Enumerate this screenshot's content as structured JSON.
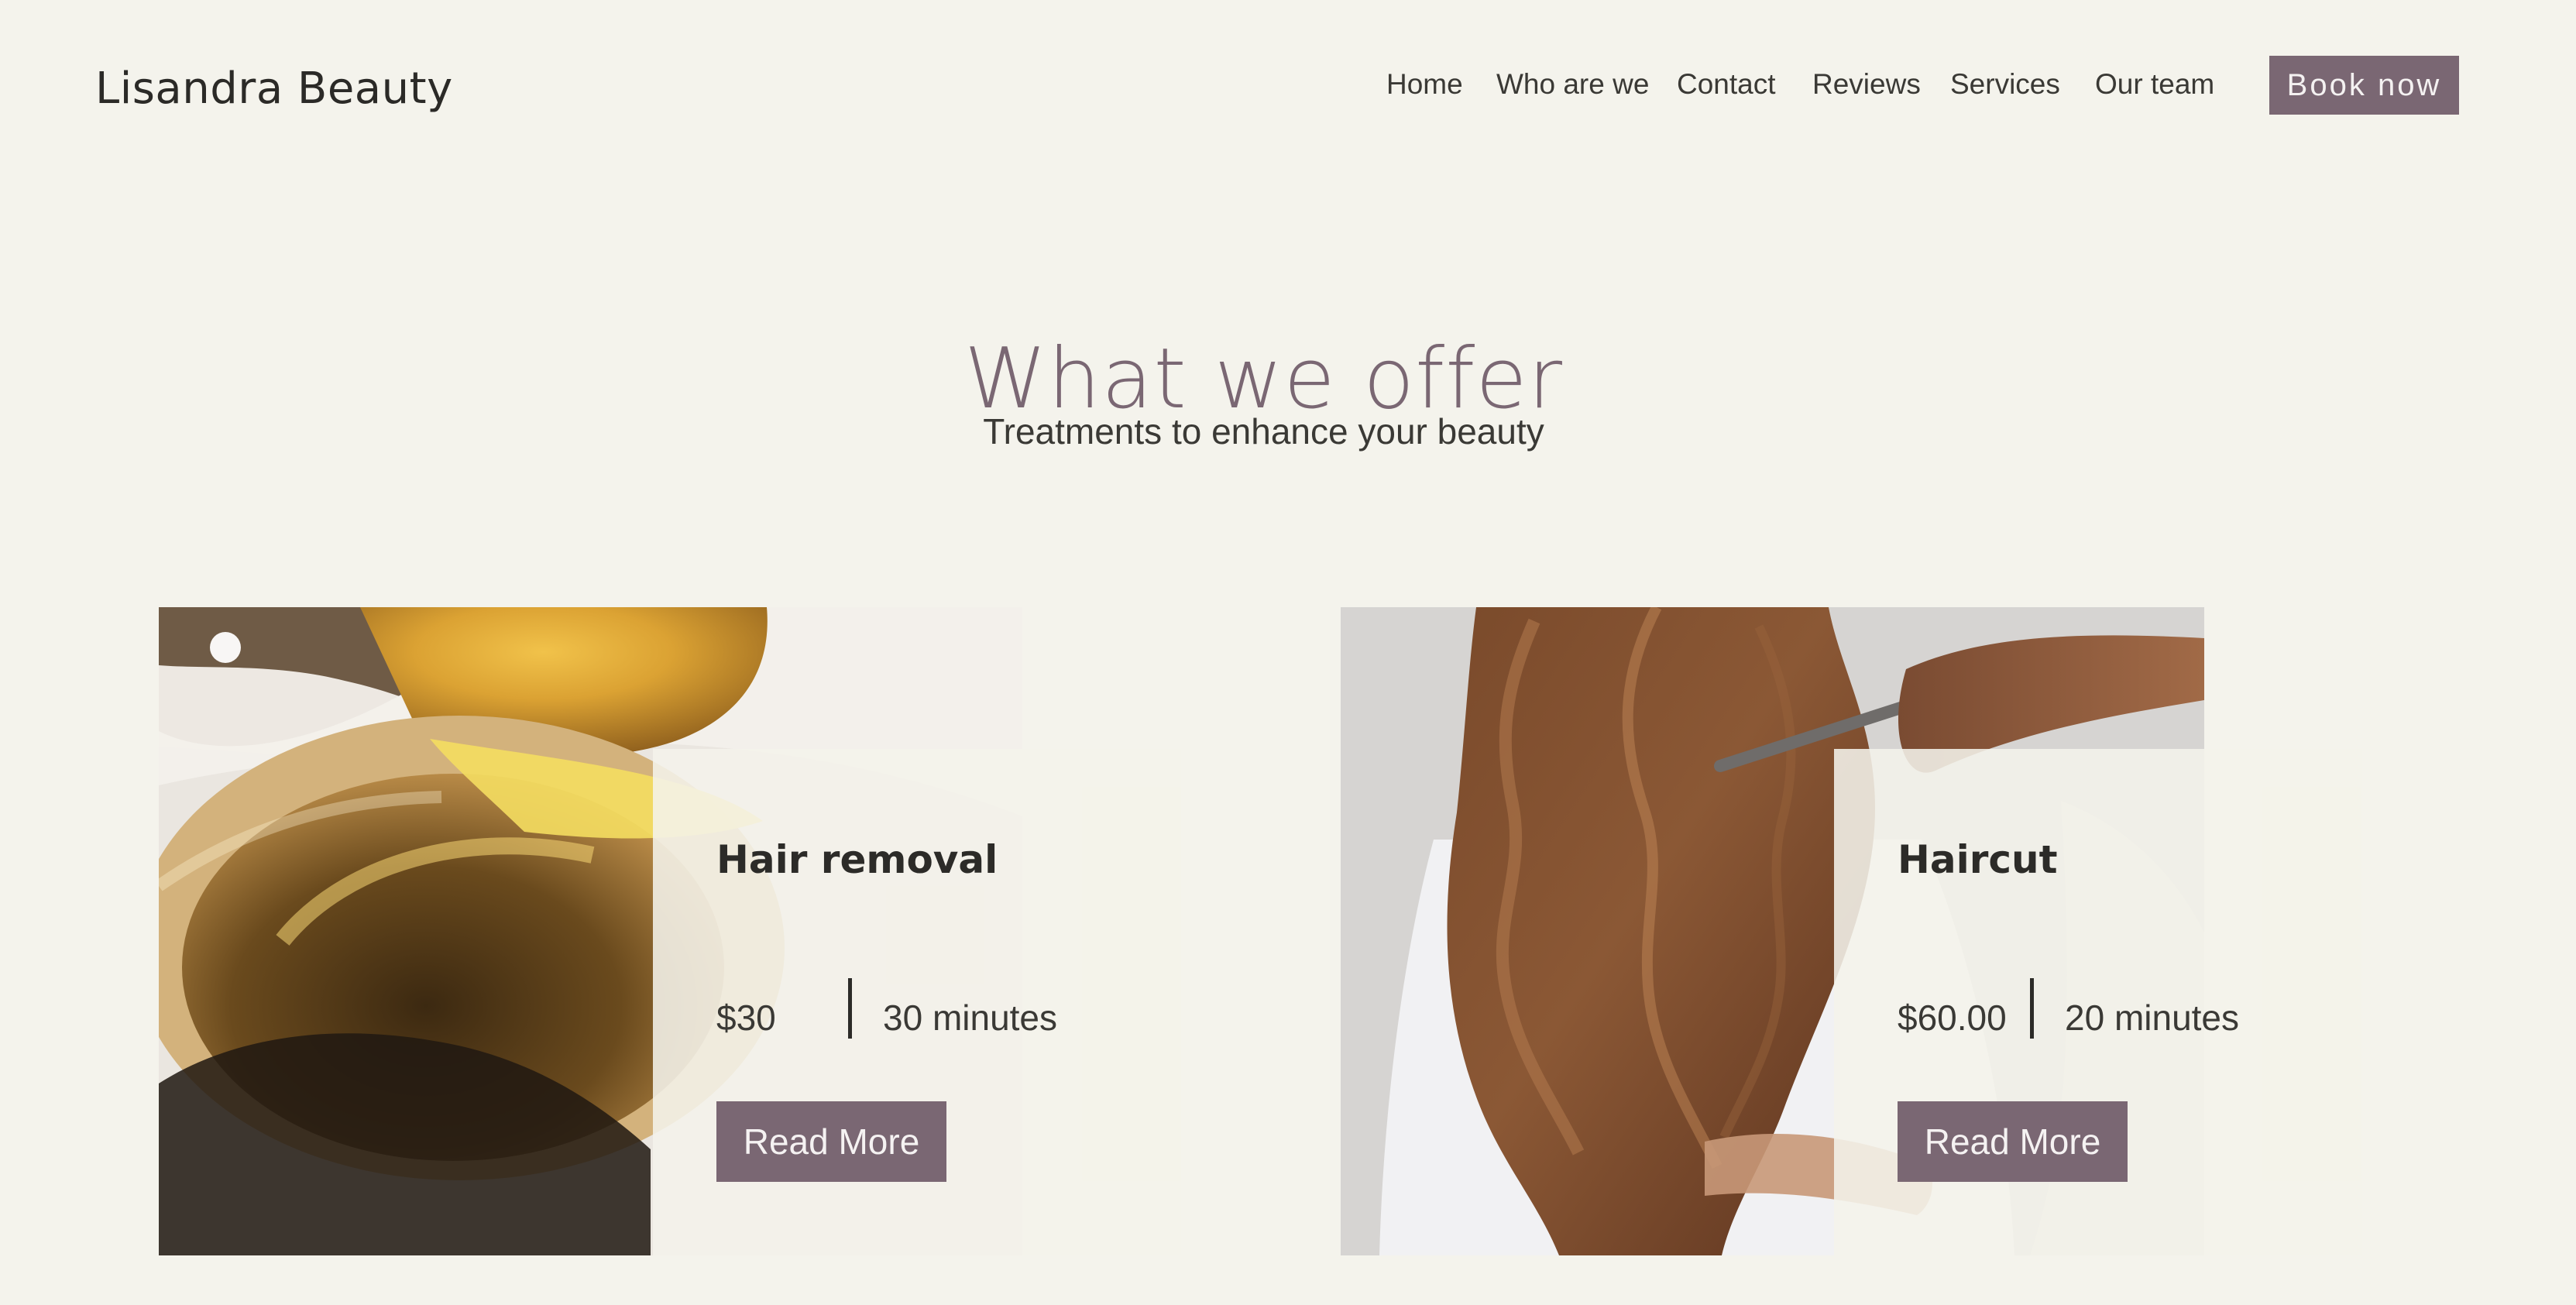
{
  "header": {
    "brand": "Lisandra Beauty",
    "nav": {
      "home": "Home",
      "who": "Who are we",
      "contact": "Contact",
      "reviews": "Reviews",
      "services": "Services",
      "team": "Our team"
    },
    "book_label": "Book now"
  },
  "hero": {
    "title": "What we offer",
    "subtitle": "Treatments to enhance your beauty"
  },
  "services": [
    {
      "title": "Hair removal",
      "price": "$30",
      "duration": "30 minutes",
      "button": "Read More",
      "image_subject": "melted wax in a pot"
    },
    {
      "title": "Haircut",
      "price": "$60.00",
      "duration": "20 minutes",
      "button": "Read More",
      "image_subject": "long wavy brown hair with comb"
    }
  ],
  "colors": {
    "background": "#f4f3ec",
    "accent": "#7a6773",
    "text": "#2c2b28"
  }
}
